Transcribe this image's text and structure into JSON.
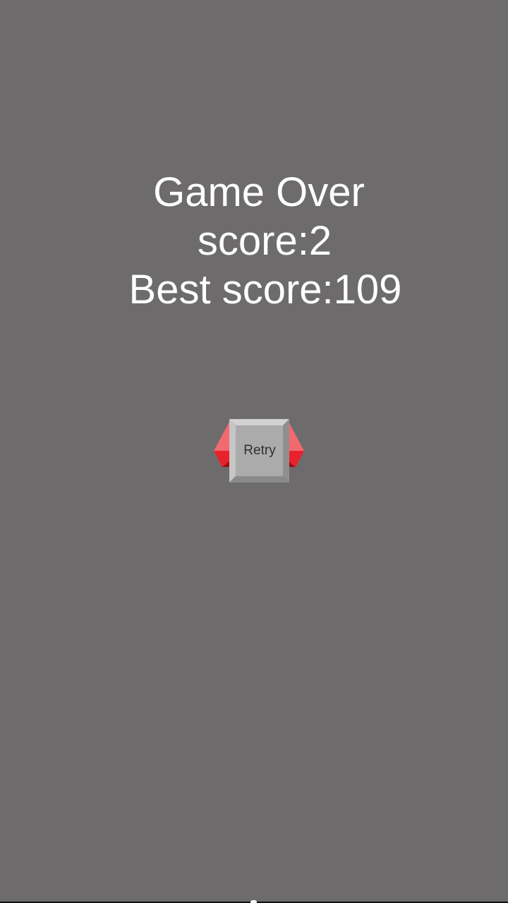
{
  "game_over": {
    "title": "Game Over",
    "score_text": "score:2",
    "best_score_text": "Best score:109"
  },
  "retry_button": {
    "label": "Retry"
  },
  "colors": {
    "background": "#6d6b6c",
    "text": "#ffffff",
    "button_face": "#ababab",
    "wing_red": "#e8222d",
    "wing_highlight": "#f06a70"
  }
}
